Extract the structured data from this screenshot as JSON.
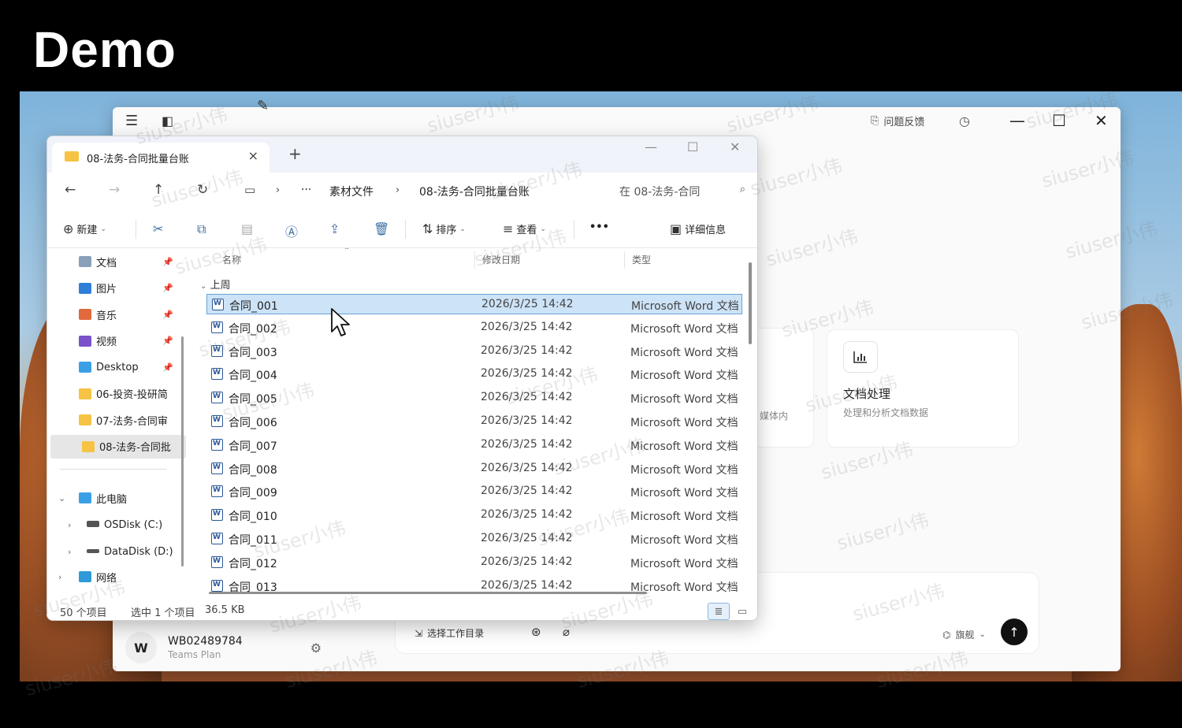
{
  "video_title": "Demo",
  "background_app": {
    "feedback_label": "问题反馈",
    "cards": [
      {
        "desc_partial": "媒体内"
      },
      {
        "icon": "bar-chart-icon",
        "title": "文档处理",
        "desc": "处理和分析文档数据"
      }
    ],
    "input": {
      "select_dir_label": "选择工作目录",
      "model_label": "旗舰"
    },
    "user": {
      "avatar_letter": "W",
      "name": "WB02489784",
      "plan": "Teams Plan"
    }
  },
  "explorer": {
    "tab_title": "08-法务-合同批量台账",
    "breadcrumb": [
      "素材文件",
      "08-法务-合同批量台账"
    ],
    "ellipsis": "···",
    "search_placeholder": "在 08-法务-合同",
    "toolbar": {
      "new": "新建",
      "sort": "排序",
      "view": "查看",
      "more": "•••",
      "details": "详细信息"
    },
    "sidebar": {
      "quick": [
        {
          "label": "文档",
          "color": "#8aa0b8"
        },
        {
          "label": "图片",
          "color": "#2f7fd8"
        },
        {
          "label": "音乐",
          "color": "#e06a3c"
        },
        {
          "label": "视频",
          "color": "#7a52c9"
        },
        {
          "label": "Desktop",
          "color": "#3aa0e6"
        },
        {
          "label": "06-投资-投研简",
          "color": "#f6c344"
        },
        {
          "label": "07-法务-合同审",
          "color": "#f6c344"
        },
        {
          "label": "08-法务-合同批",
          "color": "#f6c344"
        }
      ],
      "this_pc": "此电脑",
      "drives": [
        "OSDisk (C:)",
        "DataDisk (D:)"
      ],
      "network": "网络"
    },
    "columns": {
      "name": "名称",
      "modified": "修改日期",
      "type": "类型"
    },
    "group_label": "上周",
    "files": [
      {
        "name": "合同_001",
        "date": "2026/3/25 14:42",
        "type": "Microsoft Word 文档"
      },
      {
        "name": "合同_002",
        "date": "2026/3/25 14:42",
        "type": "Microsoft Word 文档"
      },
      {
        "name": "合同_003",
        "date": "2026/3/25 14:42",
        "type": "Microsoft Word 文档"
      },
      {
        "name": "合同_004",
        "date": "2026/3/25 14:42",
        "type": "Microsoft Word 文档"
      },
      {
        "name": "合同_005",
        "date": "2026/3/25 14:42",
        "type": "Microsoft Word 文档"
      },
      {
        "name": "合同_006",
        "date": "2026/3/25 14:42",
        "type": "Microsoft Word 文档"
      },
      {
        "name": "合同_007",
        "date": "2026/3/25 14:42",
        "type": "Microsoft Word 文档"
      },
      {
        "name": "合同_008",
        "date": "2026/3/25 14:42",
        "type": "Microsoft Word 文档"
      },
      {
        "name": "合同_009",
        "date": "2026/3/25 14:42",
        "type": "Microsoft Word 文档"
      },
      {
        "name": "合同_010",
        "date": "2026/3/25 14:42",
        "type": "Microsoft Word 文档"
      },
      {
        "name": "合同_011",
        "date": "2026/3/25 14:42",
        "type": "Microsoft Word 文档"
      },
      {
        "name": "合同_012",
        "date": "2026/3/25 14:42",
        "type": "Microsoft Word 文档"
      },
      {
        "name": "合同_013",
        "date": "2026/3/25 14:42",
        "type": "Microsoft Word 文档"
      }
    ],
    "status": {
      "count": "50 个项目",
      "selected": "选中 1 个项目",
      "size": "36.5 KB"
    }
  },
  "watermark_text": "siuser小伟"
}
